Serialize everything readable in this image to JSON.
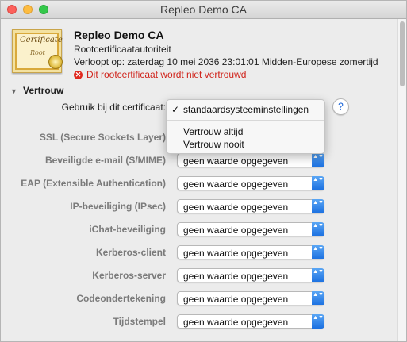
{
  "window": {
    "title": "Repleo Demo CA"
  },
  "certificate": {
    "icon_text": "Certificate",
    "icon_subtext": "Root",
    "name": "Repleo Demo CA",
    "kind": "Rootcertificaatautoriteit",
    "expires": "Verloopt op: zaterdag 10 mei 2036 23:01:01 Midden-Europese zomertijd",
    "warning": "Dit rootcertificaat wordt niet vertrouwd"
  },
  "trust": {
    "section_label": "Vertrouw",
    "use_label": "Gebruik bij dit certificaat:",
    "use_value": "standaardsysteeminstellingen",
    "menu": {
      "selected": "standaardsysteeminstellingen",
      "options": [
        "Vertrouw altijd",
        "Vertrouw nooit"
      ]
    },
    "help": "?",
    "rows": [
      {
        "label": "SSL (Secure Sockets Layer)",
        "value": ""
      },
      {
        "label": "Beveiligde e-mail (S/MIME)",
        "value": "geen waarde opgegeven"
      },
      {
        "label": "EAP (Extensible Authentication)",
        "value": "geen waarde opgegeven"
      },
      {
        "label": "IP-beveiliging (IPsec)",
        "value": "geen waarde opgegeven"
      },
      {
        "label": "iChat-beveiliging",
        "value": "geen waarde opgegeven"
      },
      {
        "label": "Kerberos-client",
        "value": "geen waarde opgegeven"
      },
      {
        "label": "Kerberos-server",
        "value": "geen waarde opgegeven"
      },
      {
        "label": "Codeondertekening",
        "value": "geen waarde opgegeven"
      },
      {
        "label": "Tijdstempel",
        "value": "geen waarde opgegeven"
      }
    ]
  },
  "icons": {
    "disclosure": "▼",
    "check": "✓",
    "error": "✕",
    "stepper": "▲▼"
  },
  "colors": {
    "warning": "#d0241c",
    "accent": "#1a6fe0"
  }
}
